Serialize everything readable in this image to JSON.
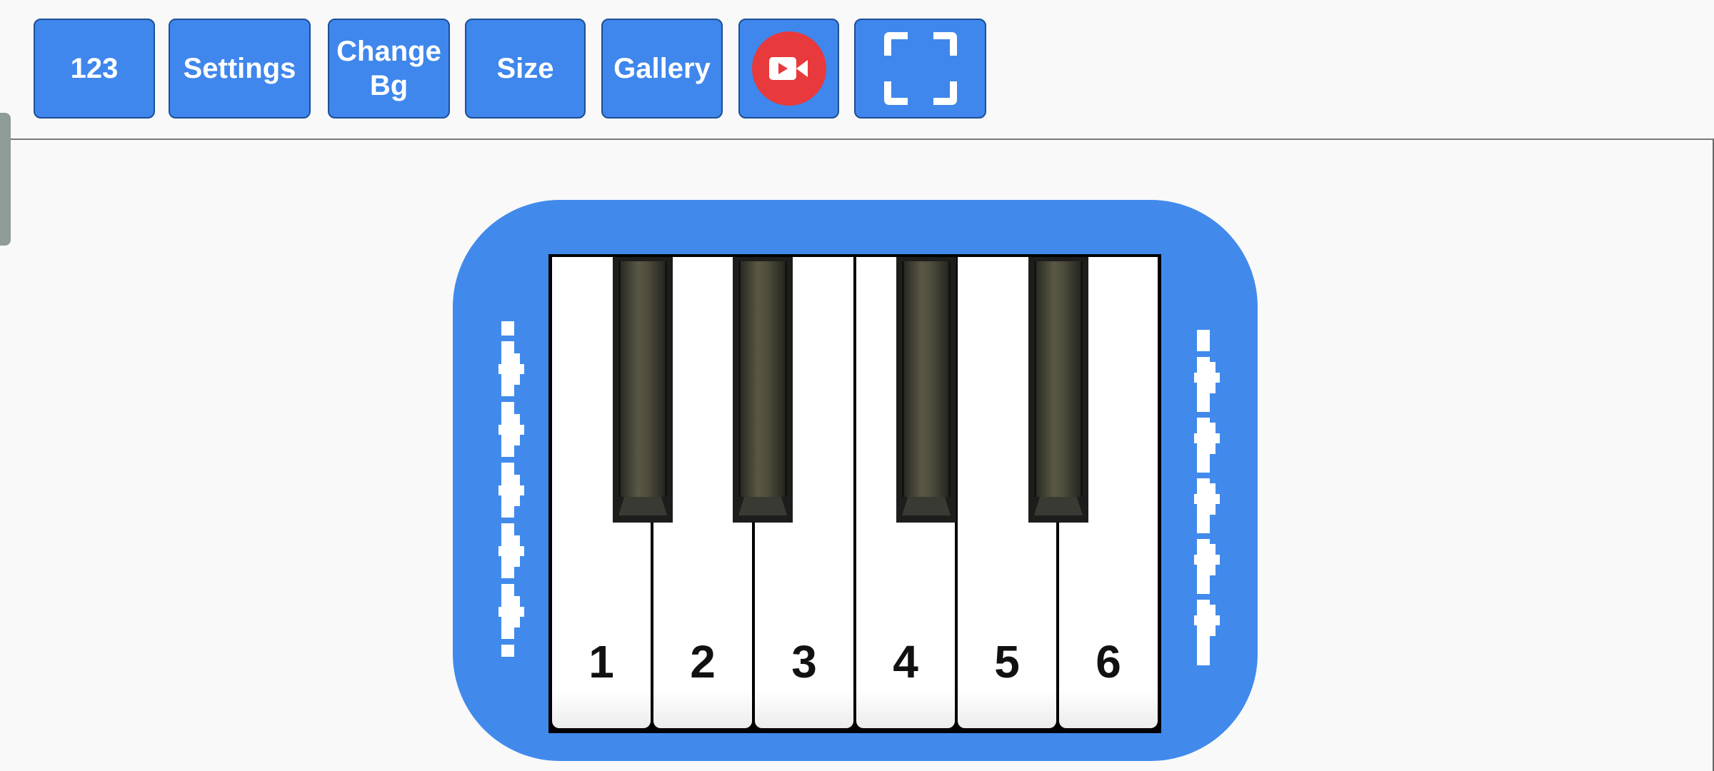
{
  "toolbar": {
    "numbers_label": "123",
    "settings_label": "Settings",
    "change_bg_label": "Change\nBg",
    "size_label": "Size",
    "gallery_label": "Gallery",
    "record_icon": "video-record-icon",
    "fullscreen_icon": "fullscreen-icon"
  },
  "piano": {
    "white_keys": [
      {
        "label": "1"
      },
      {
        "label": "2"
      },
      {
        "label": "3"
      },
      {
        "label": "4"
      },
      {
        "label": "5"
      },
      {
        "label": "6"
      }
    ],
    "black_key_count": 4
  },
  "colors": {
    "button_blue": "#3f87ec",
    "piano_body_blue": "#418aec",
    "record_red": "#e8393c",
    "background": "#f9f9f9"
  }
}
